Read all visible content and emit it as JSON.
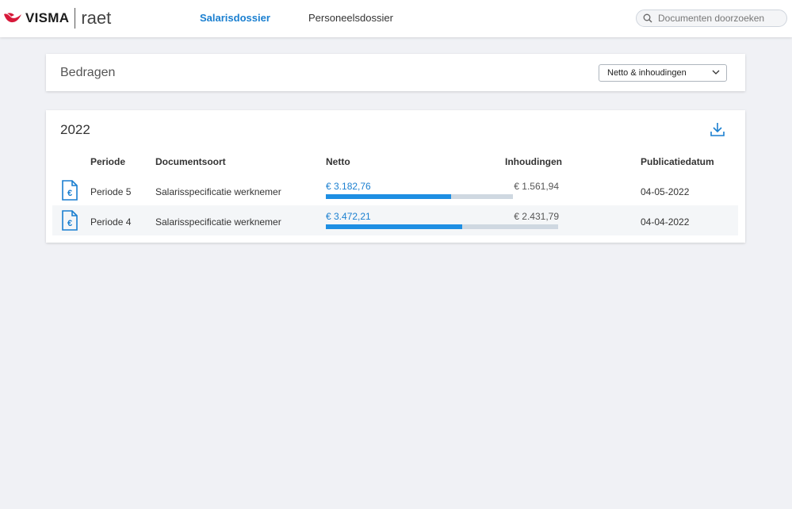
{
  "header": {
    "brand": "VISMA",
    "product": "raet",
    "nav": [
      {
        "label": "Salarisdossier",
        "active": true
      },
      {
        "label": "Personeelsdossier",
        "active": false
      }
    ],
    "search_placeholder": "Documenten doorzoeken"
  },
  "amounts_card": {
    "title": "Bedragen",
    "select_value": "Netto & inhoudingen"
  },
  "year_card": {
    "year": "2022",
    "columns": [
      "Periode",
      "Documentsoort",
      "Netto",
      "Inhoudingen",
      "Publicatiedatum"
    ],
    "rows": [
      {
        "periode": "Periode 5",
        "documentsoort": "Salarisspecificatie werknemer",
        "netto": "€ 3.182,76",
        "inhoudingen": "€ 1.561,94",
        "datum": "04-05-2022",
        "netto_fraction": 0.67
      },
      {
        "periode": "Periode 4",
        "documentsoort": "Salarisspecificatie werknemer",
        "netto": "€ 3.472,21",
        "inhoudingen": "€ 2.431,79",
        "datum": "04-04-2022",
        "netto_fraction": 0.588
      }
    ]
  },
  "colors": {
    "accent": "#1a7fd0",
    "bar_fill": "#1e8fe3",
    "bar_track": "#cfd8e1",
    "brand_red": "#d7193a"
  }
}
